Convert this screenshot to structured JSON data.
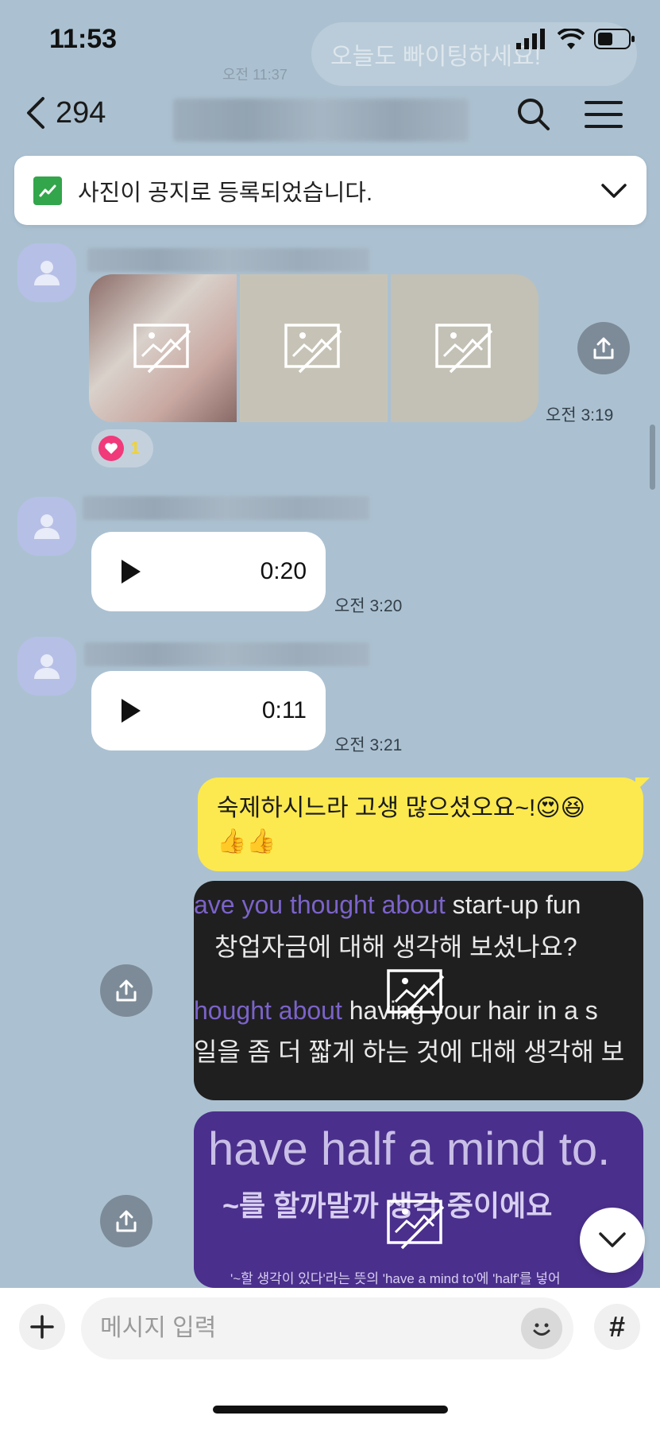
{
  "status_bar": {
    "time": "11:53"
  },
  "background_overlay": {
    "ghost_message": "오늘도 빠이팅하세요!",
    "ghost_time": "오전 11:37"
  },
  "header": {
    "member_count": "294"
  },
  "notice": {
    "text": "사진이 공지로 등록되었습니다."
  },
  "messages": [
    {
      "type": "images",
      "count": 3,
      "time": "오전 3:19",
      "reaction": {
        "icon": "heart-icon",
        "count": "1"
      }
    },
    {
      "type": "voice",
      "duration": "0:20",
      "time": "오전 3:20"
    },
    {
      "type": "voice",
      "duration": "0:11",
      "time": "오전 3:21"
    },
    {
      "type": "text",
      "mine": true,
      "line1": "숙제하시느라 고생 많으셨오요~!😍😆",
      "line2": "👍👍"
    },
    {
      "type": "image",
      "mine": true,
      "lines": [
        {
          "hl": "ave you thought about",
          "rest": " start-up fun"
        },
        {
          "hl": "",
          "rest": "창업자금에 대해 생각해 보셨나요?"
        },
        {
          "hl": "hought about",
          "rest": " having your hair in a s"
        },
        {
          "hl": "",
          "rest": "일을 좀 더 짧게 하는 것에 대해 생각해 보"
        }
      ]
    },
    {
      "type": "image",
      "mine": true,
      "title": "have half a mind to.",
      "subtitle": "~를 할까말까 생각 중이에요",
      "caption": "'~할 생각이 있다'라는 뜻의 'have a mind to'에 'half'를 넣어"
    }
  ],
  "input": {
    "placeholder": "메시지 입력",
    "hash": "#"
  },
  "colors": {
    "background": "#abc1d1",
    "my_bubble": "#fce94f",
    "notice_icon": "#33a54b",
    "reaction_heart": "#f03a7a"
  }
}
